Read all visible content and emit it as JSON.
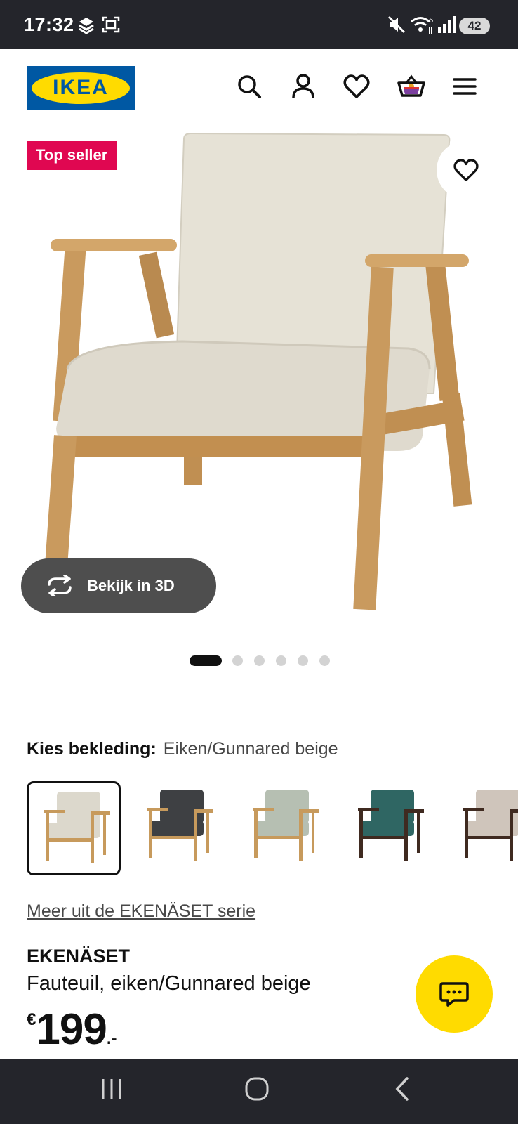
{
  "status_bar": {
    "time": "17:32",
    "battery": "42",
    "icons": [
      "stack-icon",
      "screenshot-icon",
      "mute-icon",
      "wifi-icon",
      "signal-icon"
    ]
  },
  "header": {
    "logo_text": "IKEA",
    "brand_blue": "#0058a3",
    "brand_yellow": "#ffdb00",
    "icons": [
      "search-icon",
      "account-icon",
      "heart-icon",
      "cart-icon",
      "menu-icon"
    ]
  },
  "product_image": {
    "badge": "Top seller",
    "badge_color": "#e00751",
    "view_3d_label": "Bekijk in 3D",
    "image_count": 6,
    "active_image": 1
  },
  "variant": {
    "label": "Kies bekleding:",
    "value": "Eiken/Gunnared beige",
    "options": [
      {
        "fabric": "#dcd8cc",
        "frame": "#c79a5c",
        "selected": true
      },
      {
        "fabric": "#3e4043",
        "frame": "#c79a5c",
        "selected": false
      },
      {
        "fabric": "#b6bfb2",
        "frame": "#c79a5c",
        "selected": false
      },
      {
        "fabric": "#2f6663",
        "frame": "#3f2a20",
        "selected": false
      },
      {
        "fabric": "#cfc5bb",
        "frame": "#3f2a20",
        "selected": false
      }
    ]
  },
  "series_link": "Meer uit de EKENÄSET serie",
  "product": {
    "name": "EKENÄSET",
    "description": "Fauteuil, eiken/Gunnared beige",
    "price_currency": "€",
    "price_integer": "199",
    "price_decimal": ".-"
  },
  "chat_button": {
    "icon": "chat-icon",
    "color": "#ffdb00"
  },
  "nav_bar": {
    "buttons": [
      "recents-button",
      "home-button",
      "back-button"
    ]
  }
}
